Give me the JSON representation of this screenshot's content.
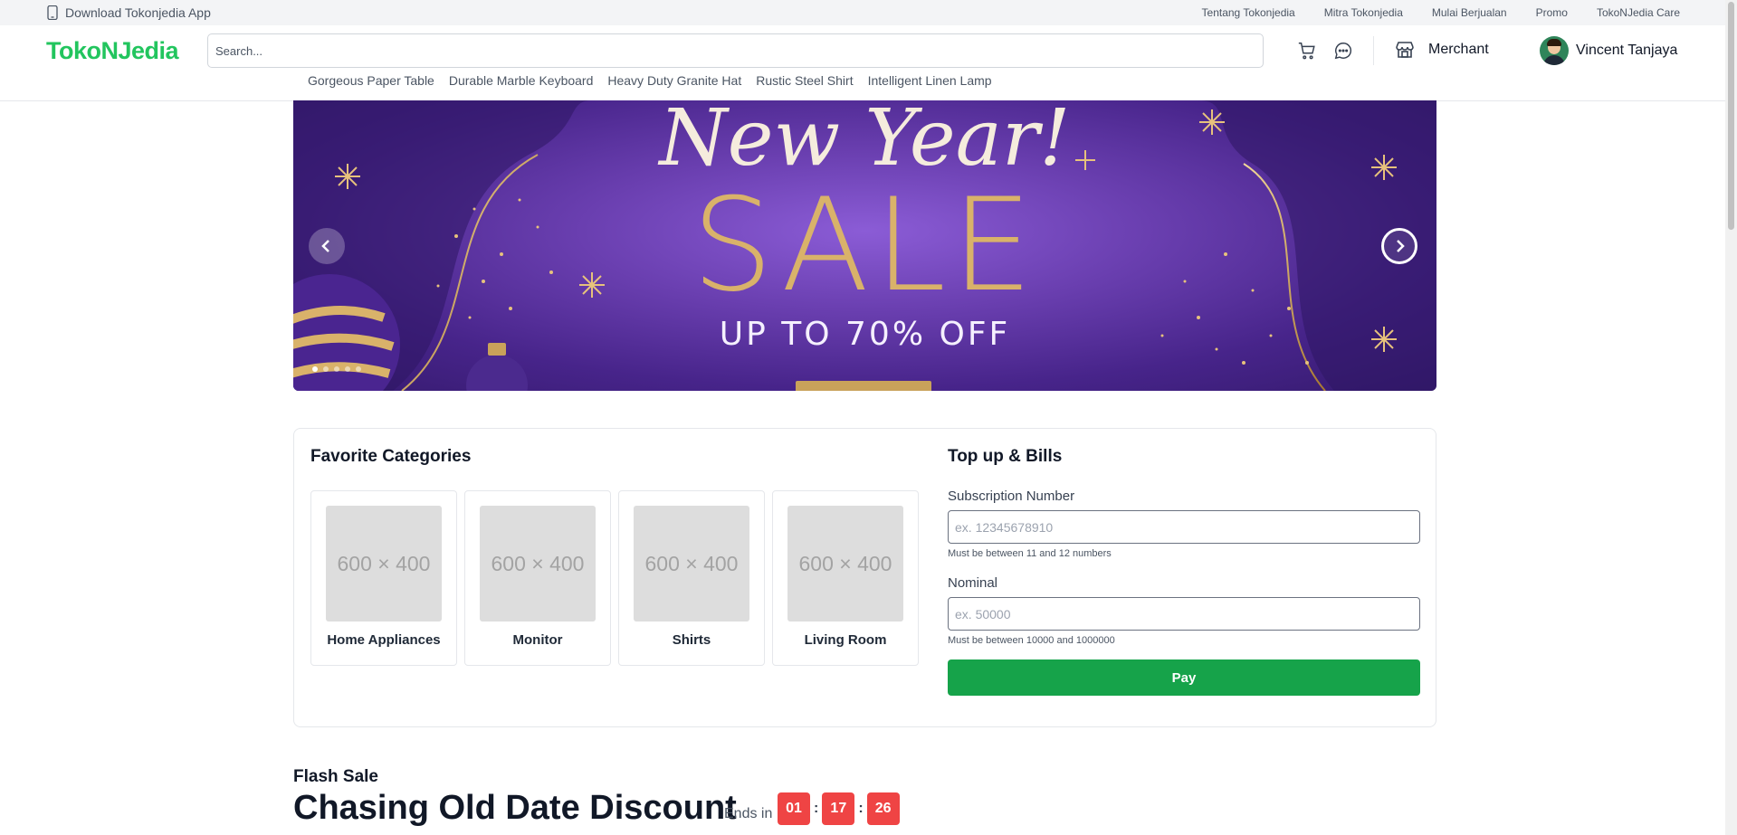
{
  "topbar": {
    "download_label": "Download Tokonjedia App",
    "links": [
      "Tentang Tokonjedia",
      "Mitra Tokonjedia",
      "Mulai Berjualan",
      "Promo",
      "TokoNJedia Care"
    ]
  },
  "header": {
    "logo": "TokoNJedia",
    "search_placeholder": "Search...",
    "merchant_label": "Merchant",
    "user_name": "Vincent Tanjaya",
    "quick_links": [
      "Gorgeous Paper Table",
      "Durable Marble Keyboard",
      "Heavy Duty Granite Hat",
      "Rustic Steel Shirt",
      "Intelligent Linen Lamp"
    ]
  },
  "banner": {
    "headline": "New Year!",
    "title": "SALE",
    "subtitle": "UP TO 70% OFF",
    "slide_count": 5,
    "active_slide": 1
  },
  "favorites": {
    "title": "Favorite Categories",
    "placeholder_text": "600 × 400",
    "items": [
      "Home Appliances",
      "Monitor",
      "Shirts",
      "Living Room"
    ]
  },
  "topup": {
    "title": "Top up & Bills",
    "subscription_label": "Subscription Number",
    "subscription_placeholder": "ex. 12345678910",
    "subscription_hint": "Must be between 11 and 12 numbers",
    "nominal_label": "Nominal",
    "nominal_placeholder": "ex. 50000",
    "nominal_hint": "Must be between 10000 and 1000000",
    "pay_label": "Pay"
  },
  "flash_sale": {
    "label": "Flash Sale",
    "title": "Chasing Old Date Discount",
    "ends_label": "Ends in",
    "hours": "01",
    "minutes": "17",
    "seconds": "26"
  },
  "colors": {
    "brand": "#22c55e",
    "pay_button": "#16a34a",
    "timer": "#ef4444",
    "banner_bg": "#5b2fa0"
  }
}
